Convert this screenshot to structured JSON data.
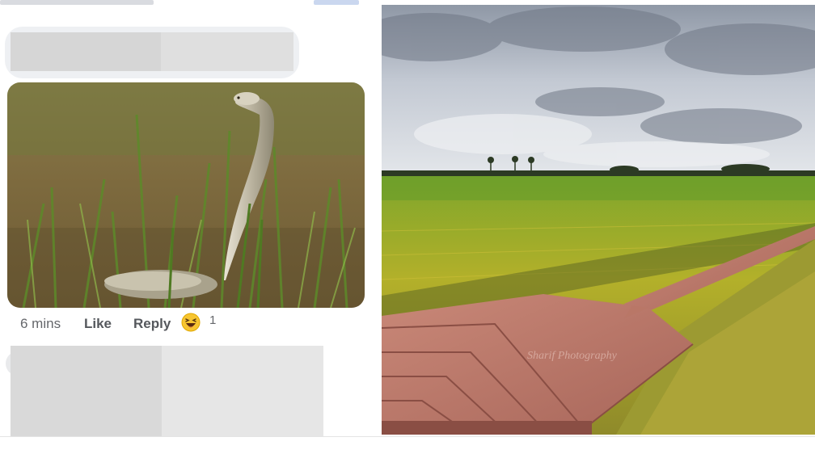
{
  "comment": {
    "time_label": "6 mins",
    "like_label": "Like",
    "reply_label": "Reply",
    "reaction_icon": "haha-emoji-icon",
    "reaction_count": "1",
    "photo_subject": "cobra-in-grass-photo"
  },
  "landscape": {
    "photo_subject": "rice-field-boardwalk-photo",
    "watermark": "Sharif Photography"
  },
  "colors": {
    "action_gray": "#65676b",
    "bubble_bg": "#eef0f3",
    "boardwalk": "#b7776a"
  }
}
